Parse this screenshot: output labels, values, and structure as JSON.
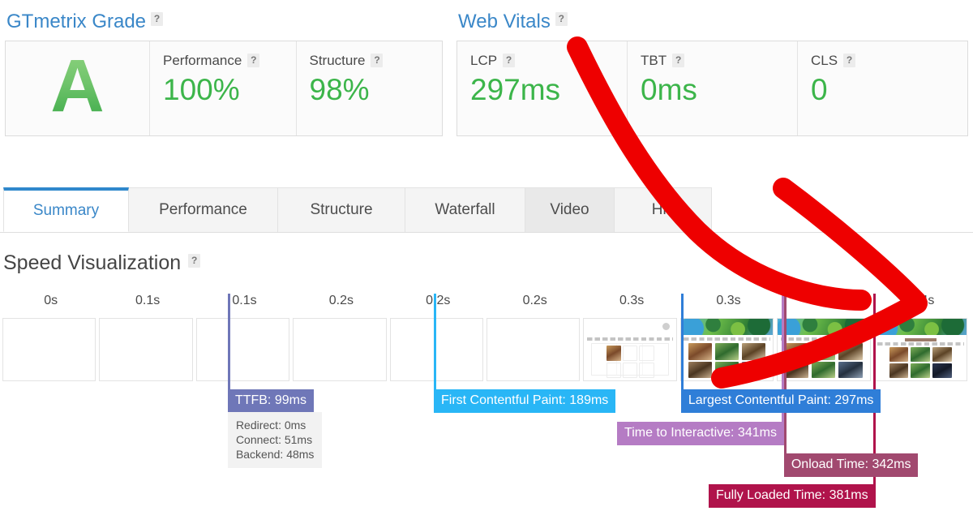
{
  "grade_section": {
    "title": "GTmetrix Grade",
    "help": "?",
    "grade": "A",
    "metrics": [
      {
        "label": "Performance",
        "help": "?",
        "value": "100%"
      },
      {
        "label": "Structure",
        "help": "?",
        "value": "98%"
      }
    ]
  },
  "vitals_section": {
    "title": "Web Vitals",
    "help": "?",
    "metrics": [
      {
        "label": "LCP",
        "help": "?",
        "value": "297ms"
      },
      {
        "label": "TBT",
        "help": "?",
        "value": "0ms"
      },
      {
        "label": "CLS",
        "help": "?",
        "value": "0"
      }
    ]
  },
  "tabs": [
    {
      "label": "Summary",
      "state": "active"
    },
    {
      "label": "Performance",
      "state": "normal"
    },
    {
      "label": "Structure",
      "state": "normal"
    },
    {
      "label": "Waterfall",
      "state": "normal"
    },
    {
      "label": "Video",
      "state": "hovered"
    },
    {
      "label": "His",
      "state": "normal"
    }
  ],
  "speed_visualization": {
    "title": "Speed Visualization",
    "help": "?"
  },
  "chart_data": {
    "type": "timeline",
    "title": "Speed Visualization",
    "xlabel": "",
    "ylabel": "",
    "axis_unit": "s",
    "xlim": [
      0,
      0.4
    ],
    "tick_labels": [
      "0s",
      "0.1s",
      "0.1s",
      "0.2s",
      "0.2s",
      "0.2s",
      "0.3s",
      "0.3s",
      "0.3s",
      "0.4s"
    ],
    "frames": [
      {
        "tick": "0s",
        "content": "blank"
      },
      {
        "tick": "0.1s",
        "content": "blank"
      },
      {
        "tick": "0.1s",
        "content": "blank"
      },
      {
        "tick": "0.2s",
        "content": "blank"
      },
      {
        "tick": "0.2s",
        "content": "blank"
      },
      {
        "tick": "0.2s",
        "content": "blank"
      },
      {
        "tick": "0.3s",
        "content": "skeleton"
      },
      {
        "tick": "0.3s",
        "content": "partial"
      },
      {
        "tick": "0.3s",
        "content": "partial"
      },
      {
        "tick": "0.4s",
        "content": "complete"
      }
    ],
    "markers": [
      {
        "name": "TTFB",
        "label": "TTFB: 99ms",
        "value_ms": 99,
        "color": "#6f77b8"
      },
      {
        "name": "First Contentful Paint",
        "label": "First Contentful Paint: 189ms",
        "value_ms": 189,
        "color": "#29b6f6"
      },
      {
        "name": "Largest Contentful Paint",
        "label": "Largest Contentful Paint: 297ms",
        "value_ms": 297,
        "color": "#2f7ed8"
      },
      {
        "name": "Time to Interactive",
        "label": "Time to Interactive: 341ms",
        "value_ms": 341,
        "color": "#b57cc4"
      },
      {
        "name": "Onload Time",
        "label": "Onload Time: 342ms",
        "value_ms": 342,
        "color": "#a1496f"
      },
      {
        "name": "Fully Loaded Time",
        "label": "Fully Loaded Time: 381ms",
        "value_ms": 381,
        "color": "#b0134b"
      }
    ],
    "ttfb_breakdown": [
      {
        "label": "Redirect: 0ms"
      },
      {
        "label": "Connect: 51ms"
      },
      {
        "label": "Backend: 48ms"
      }
    ]
  },
  "annotation": {
    "shape": "curved-arrow",
    "color": "#ee0000",
    "points_to": "0.4s end of filmstrip"
  }
}
